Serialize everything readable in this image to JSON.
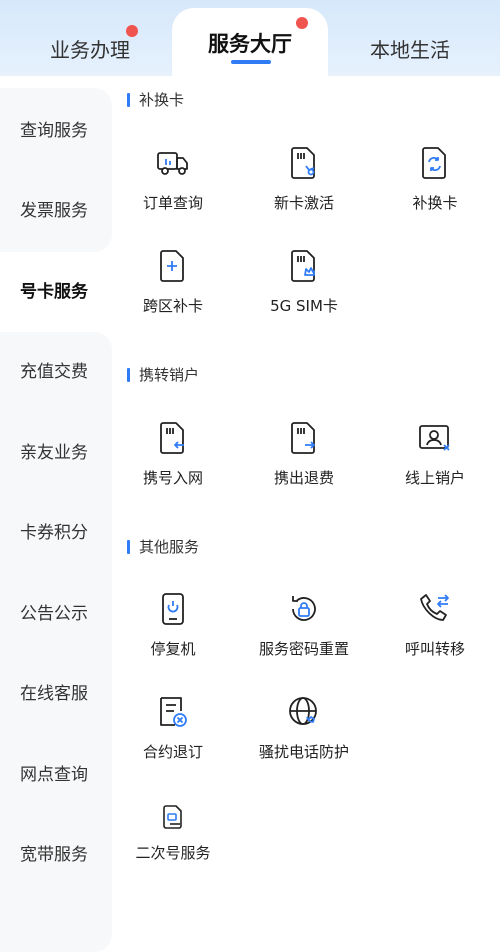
{
  "tabs": [
    {
      "label": "业务办理",
      "badge": true
    },
    {
      "label": "服务大厅",
      "badge": true,
      "active": true
    },
    {
      "label": "本地生活",
      "badge": false
    }
  ],
  "sidebar": {
    "items": [
      {
        "label": "查询服务"
      },
      {
        "label": "发票服务"
      },
      {
        "label": "号卡服务",
        "active": true
      },
      {
        "label": "充值交费"
      },
      {
        "label": "亲友业务"
      },
      {
        "label": "卡券积分"
      },
      {
        "label": "公告公示"
      },
      {
        "label": "在线客服"
      },
      {
        "label": "网点查询"
      },
      {
        "label": "宽带服务"
      }
    ]
  },
  "sections": [
    {
      "title": "补换卡",
      "items": [
        {
          "label": "订单查询",
          "icon": "truck-icon"
        },
        {
          "label": "新卡激活",
          "icon": "sim-activate-icon"
        },
        {
          "label": "补换卡",
          "icon": "sim-swap-icon"
        },
        {
          "label": "跨区补卡",
          "icon": "sim-plus-icon"
        },
        {
          "label": "5G SIM卡",
          "icon": "sim-5g-icon"
        }
      ]
    },
    {
      "title": "携转销户",
      "items": [
        {
          "label": "携号入网",
          "icon": "sim-port-in-icon"
        },
        {
          "label": "携出退费",
          "icon": "sim-port-out-icon"
        },
        {
          "label": "线上销户",
          "icon": "id-card-cancel-icon"
        }
      ]
    },
    {
      "title": "其他服务",
      "items": [
        {
          "label": "停复机",
          "icon": "phone-power-icon"
        },
        {
          "label": "服务密码重置",
          "icon": "password-reset-icon"
        },
        {
          "label": "呼叫转移",
          "icon": "call-forward-icon"
        },
        {
          "label": "合约退订",
          "icon": "contract-cancel-icon"
        },
        {
          "label": "骚扰电话防护",
          "icon": "globe-phone-icon"
        },
        {
          "label": "二次号服务",
          "icon": "sim-secondary-icon"
        }
      ]
    }
  ],
  "colors": {
    "accent": "#2f7cf6",
    "badge": "#f0544f"
  }
}
